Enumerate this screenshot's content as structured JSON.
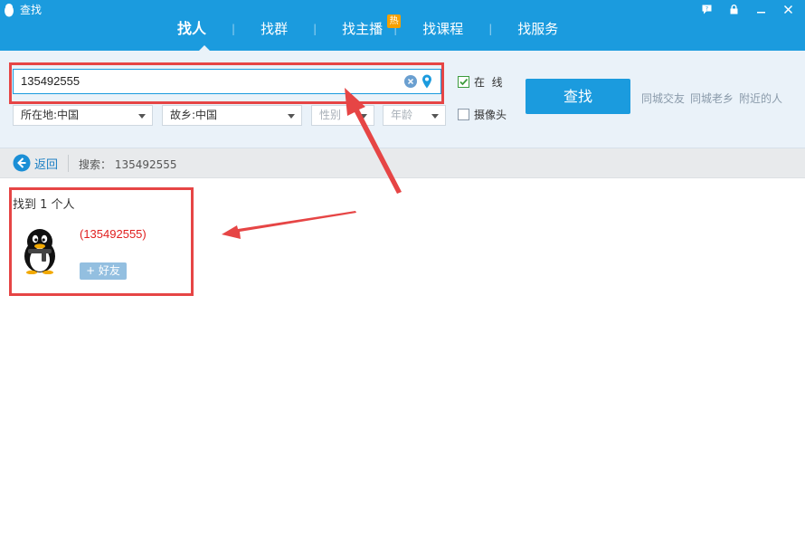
{
  "window": {
    "title": "查找",
    "controls": [
      "feedback-icon",
      "lock-icon",
      "minimize-icon",
      "close-icon"
    ]
  },
  "tabs": [
    {
      "label": "找人",
      "active": true
    },
    {
      "label": "找群",
      "active": false
    },
    {
      "label": "找主播",
      "active": false,
      "badge": "热"
    },
    {
      "label": "找课程",
      "active": false
    },
    {
      "label": "找服务",
      "active": false
    }
  ],
  "search": {
    "query": "135492555",
    "online_label": "在  线",
    "online_checked": true,
    "camera_label": "摄像头",
    "camera_checked": false,
    "find_button": "查找",
    "quick_links": [
      "同城交友",
      "同城老乡",
      "附近的人"
    ],
    "filters": {
      "location": "所在地:中国",
      "hometown": "故乡:中国",
      "gender": "性别",
      "age": "年龄"
    }
  },
  "nav": {
    "back_label": "返回",
    "crumb_prefix": "搜索：",
    "crumb_query": "135492555"
  },
  "results": {
    "count_text": "找到 1 个人",
    "items": [
      {
        "name": "(135492555)",
        "add_button": "+ 好友"
      }
    ]
  },
  "colors": {
    "primary": "#1b9bde",
    "annotation": "#e64545",
    "result_name": "#e02020",
    "badge": "#f7a000"
  }
}
